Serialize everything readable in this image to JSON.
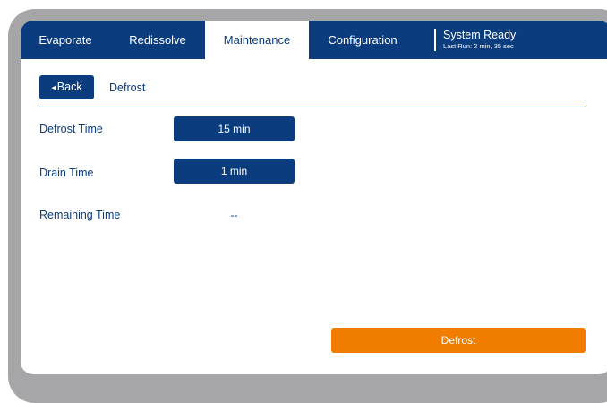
{
  "tabs": [
    {
      "label": "Evaporate",
      "active": false
    },
    {
      "label": "Redissolve",
      "active": false
    },
    {
      "label": "Maintenance",
      "active": true
    },
    {
      "label": "Configuration",
      "active": false
    }
  ],
  "status": {
    "title": "System Ready",
    "last_run": "Last Run: 2 min, 35 sec"
  },
  "nav": {
    "back_label": "Back",
    "back_icon": "triangle-left-icon",
    "page_title": "Defrost"
  },
  "fields": {
    "defrost_time": {
      "label": "Defrost Time",
      "value": "15 min"
    },
    "drain_time": {
      "label": "Drain Time",
      "value": "1 min"
    },
    "remaining_time": {
      "label": "Remaining Time",
      "value": "--"
    }
  },
  "action": {
    "label": "Defrost"
  },
  "colors": {
    "primary": "#0b3d7e",
    "accent": "#f07d00",
    "bezel": "#a6a6a8"
  }
}
